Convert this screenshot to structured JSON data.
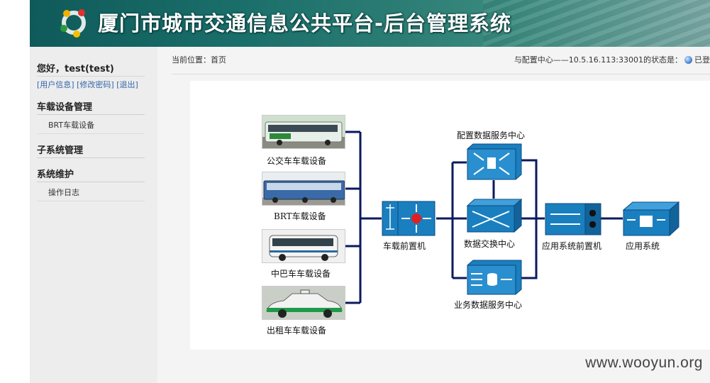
{
  "header": {
    "title": "厦门市城市交通信息公共平台-后台管理系统"
  },
  "sidebar": {
    "greeting": "您好，test(test)",
    "links": [
      "[用户信息]",
      "[修改密码]",
      "[退出]"
    ],
    "sections": [
      {
        "title": "车载设备管理",
        "items": [
          "BRT车载设备"
        ]
      },
      {
        "title": "子系统管理",
        "items": []
      },
      {
        "title": "系统维护",
        "items": [
          "操作日志"
        ]
      }
    ]
  },
  "main": {
    "breadcrumb": "当前位置：首页",
    "status_text": "与配置中心——10.5.16.113:33001的状态是：",
    "status_value": "已登"
  },
  "diagram": {
    "vehicles": [
      "公交车车载设备",
      "BRT车载设备",
      "中巴车车载设备",
      "出租车车载设备"
    ],
    "front_processor": "车载前置机",
    "config_center": "配置数据服务中心",
    "exchange_center": "数据交换中心",
    "business_center": "业务数据服务中心",
    "app_front": "应用系统前置机",
    "app_system": "应用系统"
  },
  "watermark": "www.wooyun.org",
  "colors": {
    "line": "#0b1a5e",
    "icon": "#1a7fbf",
    "sidebar_bg": "#ededed",
    "link": "#3366aa"
  }
}
